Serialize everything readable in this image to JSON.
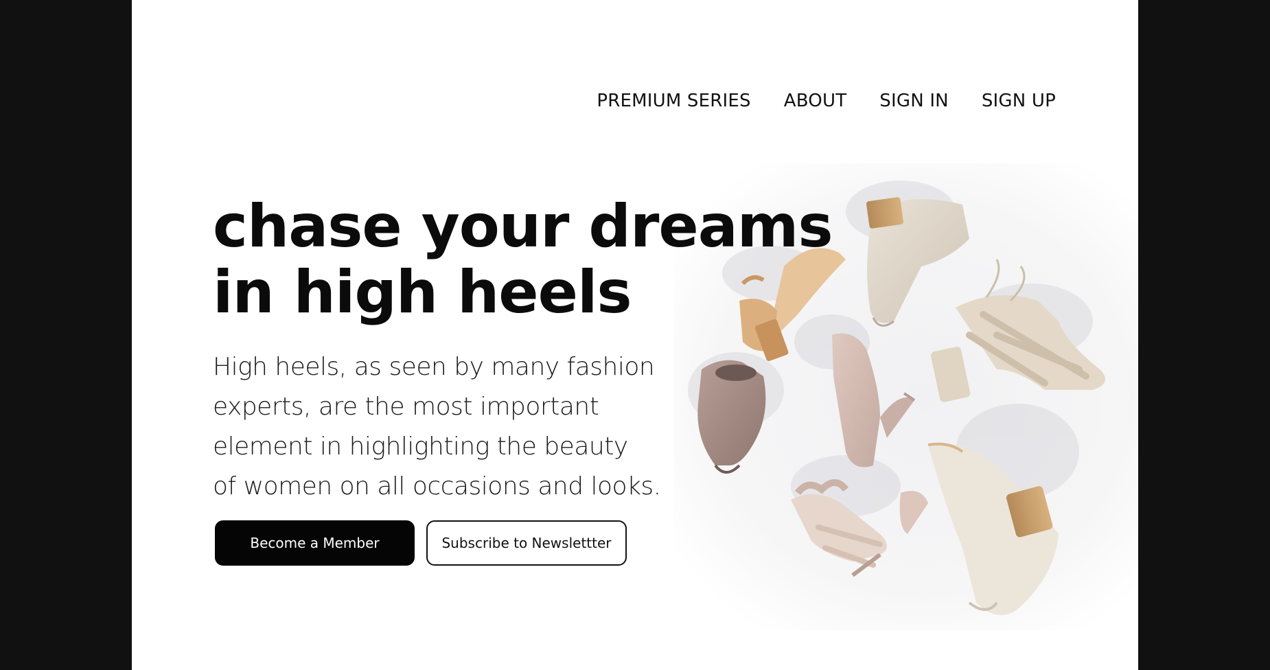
{
  "nav": {
    "items": [
      {
        "label": "PREMIUM SERIES"
      },
      {
        "label": "ABOUT"
      },
      {
        "label": "SIGN IN"
      },
      {
        "label": "SIGN UP"
      }
    ]
  },
  "hero": {
    "headline_line1": "chase your dreams",
    "headline_line2": "in high heels",
    "description": "High heels, as seen by many fashion\nexperts, are the most important\nelement in highlighting the beauty\nof women on all occasions and looks.",
    "primary_button": "Become a Member",
    "secondary_button": "Subscribe to Newslettter"
  },
  "colors": {
    "page_background": "#111111",
    "content_background": "#ffffff",
    "text": "#0b0b0b",
    "primary_button_bg": "#050505"
  },
  "image": {
    "subject": "assorted high-heel shoes"
  }
}
